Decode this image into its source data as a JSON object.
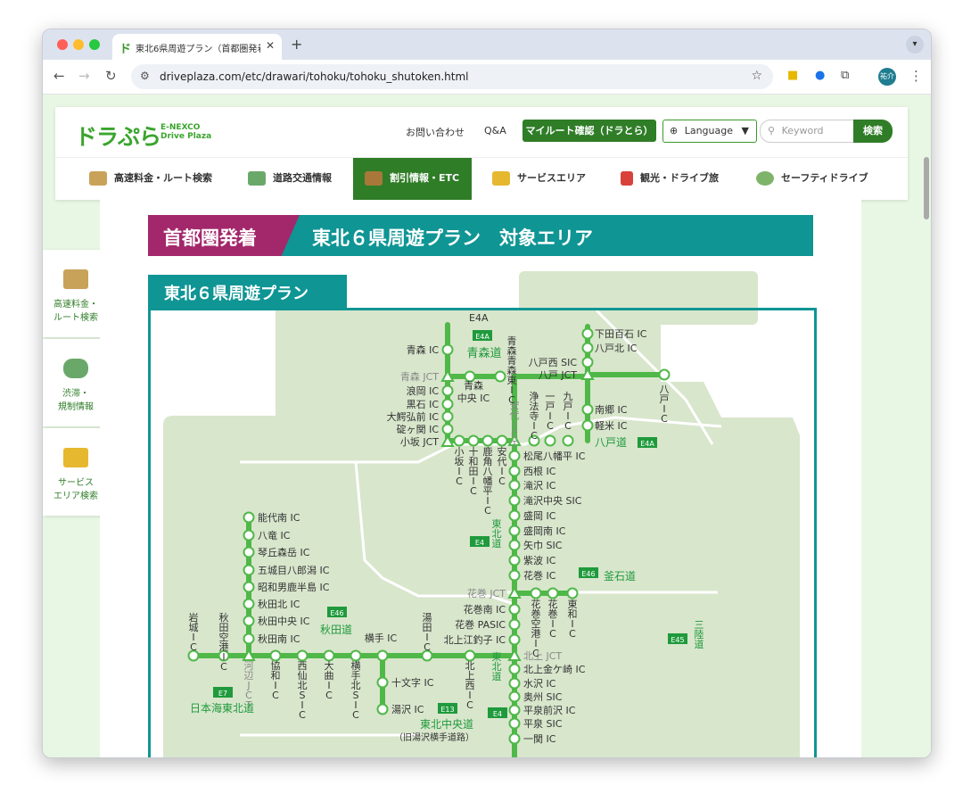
{
  "browser": {
    "tab_title": "東北6県周遊プラン（首都圏発着）",
    "tab_favicon": "ド",
    "url": "driveplaza.com/etc/drawari/tohoku/tohoku_shutoken.html",
    "avatar_label": "祐介"
  },
  "site": {
    "logo": "ドラぷら",
    "logo_sub1": "E-NEXCO",
    "logo_sub2": "Drive Plaza",
    "contact": "お問い合わせ",
    "qa": "Q&A",
    "myroute": "マイルート確認（ドラとら）",
    "language": "Language",
    "search_placeholder": "Keyword",
    "search_button": "検索",
    "nav": [
      {
        "label": "高速料金・ルート検索",
        "color": "#c9a25a"
      },
      {
        "label": "道路交通情報",
        "color": "#6aa86a"
      },
      {
        "label": "割引情報・ETC",
        "color": "#a8783a"
      },
      {
        "label": "サービスエリア",
        "color": "#e6b830"
      },
      {
        "label": "観光・ドライブ旅",
        "color": "#d8423a"
      },
      {
        "label": "セーフティドライブ",
        "color": "#7eb46a"
      }
    ],
    "side": [
      {
        "line1": "高速料金・",
        "line2": "ルート検索"
      },
      {
        "line1": "渋滞・",
        "line2": "規制情報"
      },
      {
        "line1": "サービス",
        "line2": "エリア検索"
      }
    ]
  },
  "page": {
    "badge": "首都圏発着",
    "title": "東北６県周遊プラン　対象エリア",
    "map_tab": "東北６県周遊プラン"
  },
  "map": {
    "road_color": "#4fb848",
    "roads": {
      "aomori": "青森道",
      "aomori_code": "E4A",
      "hachinohe": "八戸道",
      "hachinohe_code": "E4A",
      "tohoku": "東北道",
      "tohoku_code": "E4",
      "kamaishi": "釜石道",
      "kamaishi_code": "E46",
      "akita": "秋田道",
      "akita_code": "E46",
      "sanriku": "三陸道",
      "sanriku_code": "E45",
      "nihonkai": "日本海東北道",
      "nihonkai_code": "E7",
      "tohoku_chuo": "東北中央道",
      "tohoku_chuo_code": "E13",
      "tohoku_chuo_sub": "（旧湯沢横手道路）"
    },
    "left_labels": [
      "青森 IC",
      "青森 JCT",
      "浪岡 IC",
      "黒石 IC",
      "大鰐弘前 IC",
      "碇ヶ関 IC",
      "小坂 JCT"
    ],
    "aomori_vertical": [
      "青森東IC"
    ],
    "aomori_central": "青森中央 IC",
    "right_top": [
      "下田百石 IC",
      "八戸北 IC",
      "八戸西 SIC",
      "八戸 JCT"
    ],
    "hachinohe_ic": "八戸IC",
    "hachinohe_south": [
      "南郷 IC",
      "軽米 IC"
    ],
    "top_vertical": [
      "浄法寺IC",
      "一戸IC",
      "九戸IC"
    ],
    "anshiro": "安代JCT",
    "kosaka_vertical": [
      "小坂IC",
      "十和田IC",
      "鹿角八幡平IC",
      "安代IC"
    ],
    "tohoku_ics": [
      "松尾八幡平 IC",
      "西根 IC",
      "滝沢 IC",
      "滝沢中央 SIC",
      "盛岡 IC",
      "盛岡南 IC",
      "矢巾 SIC",
      "紫波 IC",
      "花巻 IC",
      "花巻 JCT",
      "花巻南 IC",
      "花巻 PASIC",
      "北上江釣子 IC",
      "北上 JCT",
      "北上金ケ崎 IC",
      "水沢 IC",
      "奥州 SIC",
      "平泉前沢 IC",
      "平泉 SIC",
      "一関 IC"
    ],
    "kamaishi_vertical": [
      "花巻空港IC",
      "花巻IC",
      "東和IC"
    ],
    "akita_north": [
      "能代南 IC",
      "八竜 IC",
      "琴丘森岳 IC",
      "五城目八郎潟 IC",
      "昭和男鹿半島 IC",
      "秋田北 IC",
      "秋田中央 IC",
      "秋田南 IC"
    ],
    "akita_top_vertical": [
      "岩城IC",
      "秋田空港IC",
      "湯田IC"
    ],
    "yokote": "横手 IC",
    "akita_bottom_vertical": [
      "河辺JCT",
      "協和IC",
      "西仙北SIC",
      "大曲IC",
      "横手北SIC",
      "北上西IC"
    ],
    "chuo_ics": [
      "十文字 IC",
      "湯沢 IC"
    ]
  }
}
